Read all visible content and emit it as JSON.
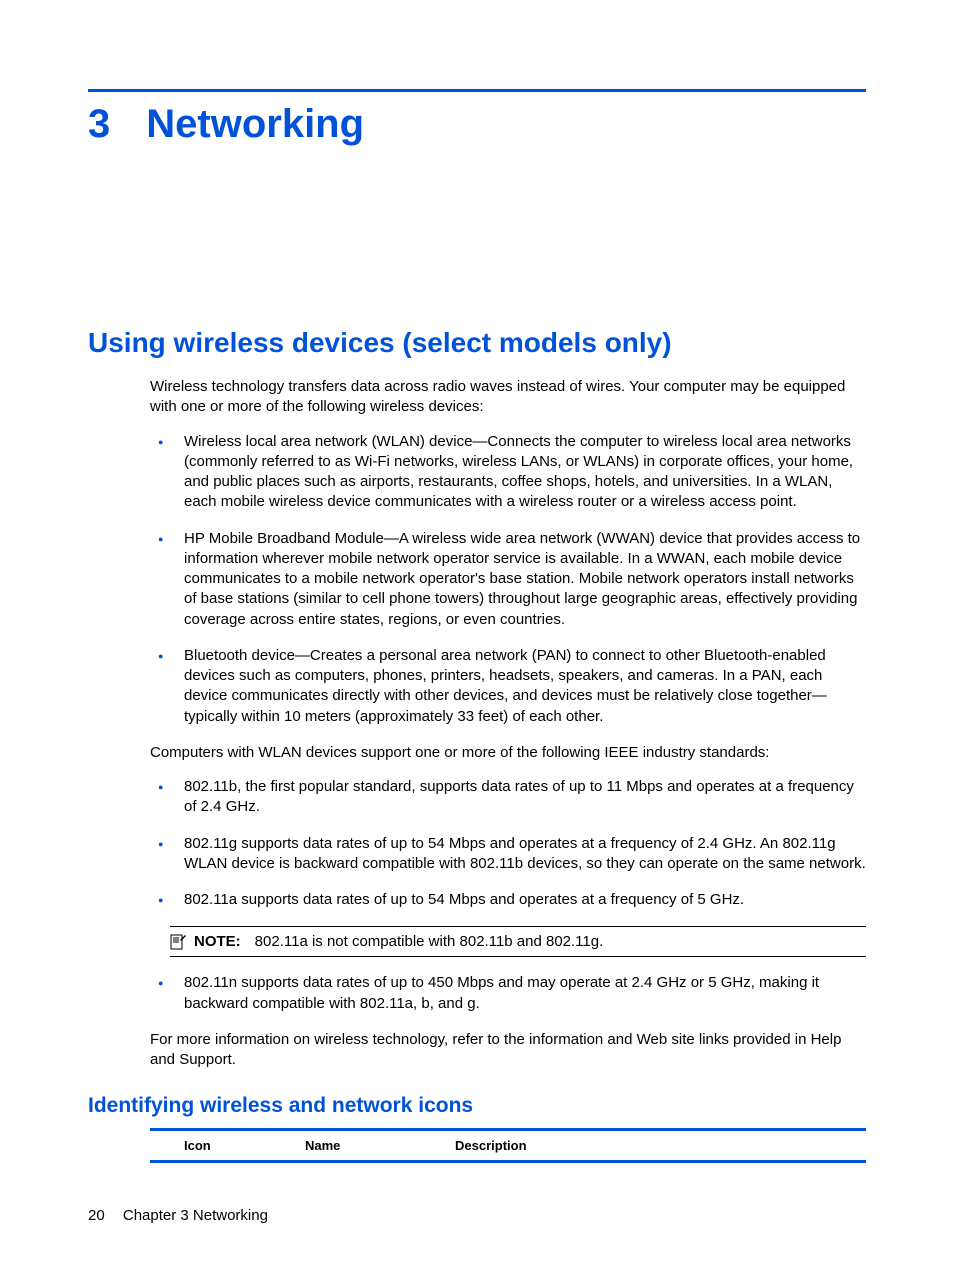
{
  "chapter": {
    "number": "3",
    "title": "Networking"
  },
  "section1": {
    "heading": "Using wireless devices (select models only)",
    "intro": "Wireless technology transfers data across radio waves instead of wires. Your computer may be equipped with one or more of the following wireless devices:",
    "bullets1": [
      "Wireless local area network (WLAN) device—Connects the computer to wireless local area networks (commonly referred to as Wi-Fi networks, wireless LANs, or WLANs) in corporate offices, your home, and public places such as airports, restaurants, coffee shops, hotels, and universities. In a WLAN, each mobile wireless device communicates with a wireless router or a wireless access point.",
      "HP Mobile Broadband Module—A wireless wide area network (WWAN) device that provides access to information wherever mobile network operator service is available. In a WWAN, each mobile device communicates to a mobile network operator's base station. Mobile network operators install networks of base stations (similar to cell phone towers) throughout large geographic areas, effectively providing coverage across entire states, regions, or even countries.",
      "Bluetooth device—Creates a personal area network (PAN) to connect to other Bluetooth-enabled devices such as computers, phones, printers, headsets, speakers, and cameras. In a PAN, each device communicates directly with other devices, and devices must be relatively close together—typically within 10 meters (approximately 33 feet) of each other."
    ],
    "para2": "Computers with WLAN devices support one or more of the following IEEE industry standards:",
    "bullets2a": [
      "802.11b, the first popular standard, supports data rates of up to 11 Mbps and operates at a frequency of 2.4 GHz.",
      "802.11g supports data rates of up to 54 Mbps and operates at a frequency of 2.4 GHz. An 802.11g WLAN device is backward compatible with 802.11b devices, so they can operate on the same network.",
      "802.11a supports data rates of up to 54 Mbps and operates at a frequency of 5 GHz."
    ],
    "note_label": "NOTE:",
    "note_text": "802.11a is not compatible with 802.11b and 802.11g.",
    "bullets2b": [
      "802.11n supports data rates of up to 450 Mbps and may operate at 2.4 GHz or 5 GHz, making it backward compatible with 802.11a, b, and g."
    ],
    "para3": "For more information on wireless technology, refer to the information and Web site links provided in Help and Support."
  },
  "section2": {
    "heading": "Identifying wireless and network icons",
    "table_headers": {
      "icon": "Icon",
      "name": "Name",
      "description": "Description"
    }
  },
  "footer": {
    "page": "20",
    "text": "Chapter 3   Networking"
  }
}
